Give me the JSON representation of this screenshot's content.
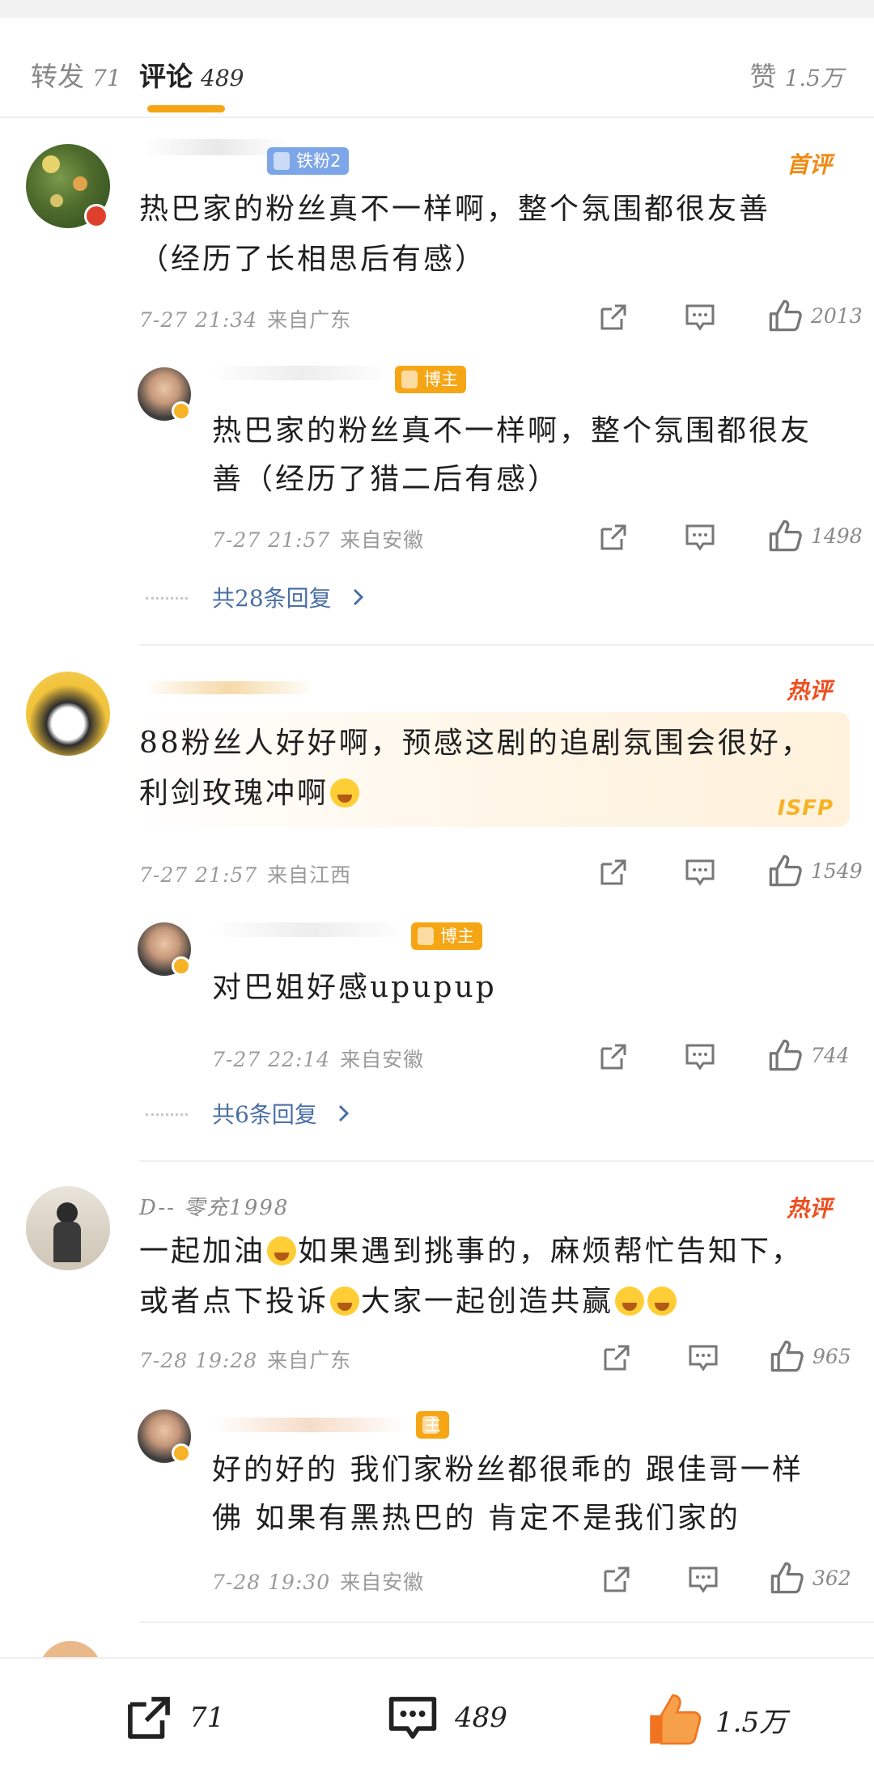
{
  "tabs": {
    "repost": {
      "label": "转发",
      "count": "71"
    },
    "comments": {
      "label": "评论",
      "count": "489"
    },
    "likes": {
      "label": "赞",
      "count": "1.5万"
    }
  },
  "comments": [
    {
      "badge": "首评",
      "fan_tag": "铁粉2",
      "text_line1": "热巴家的粉丝真不一样啊，整个氛围都很友善",
      "text_line2": "（经历了长相思后有感）",
      "time": "7-27 21:34",
      "location": "来自广东",
      "likes": "2013",
      "reply": {
        "author_tag": "博主",
        "text_line1": "热巴家的粉丝真不一样啊，整个氛围都很友",
        "text_line2": "善（经历了猎二后有感）",
        "time": "7-27 21:57",
        "location": "来自安徽",
        "likes": "1498"
      },
      "more_replies": "共28条回复"
    },
    {
      "badge": "热评",
      "text_line1": "88粉丝人好好啊，预感这剧的追剧氛围会很好，",
      "text_line2": "利剑玫瑰冲啊",
      "decoration": "ISFP",
      "time": "7-27 21:57",
      "location": "来自江西",
      "likes": "1549",
      "reply": {
        "author_tag": "博主",
        "text_line1": "对巴姐好感upupup",
        "time": "7-27 22:14",
        "location": "来自安徽",
        "likes": "744"
      },
      "more_replies": "共6条回复"
    },
    {
      "badge": "热评",
      "username": "D-- 零充1998",
      "text_line1a": "一起加油",
      "text_line1b": "如果遇到挑事的，麻烦帮忙告知下，",
      "text_line2a": "或者点下投诉",
      "text_line2b": "大家一起创造共赢",
      "time": "7-28 19:28",
      "location": "来自广东",
      "likes": "965",
      "reply": {
        "author_tag": "主",
        "text_line1": "好的好的 我们家粉丝都很乖的 跟佳哥一样",
        "text_line2": "佛 如果有黑热巴的 肯定不是我们家的",
        "time": "7-28 19:30",
        "location": "来自安徽",
        "likes": "362"
      }
    }
  ],
  "bottom_bar": {
    "repost": "71",
    "comments": "489",
    "likes": "1.5万"
  },
  "colors": {
    "accent": "#f6a615",
    "hot": "#ee4e1f",
    "link": "#4a6fa5",
    "like_active": "#f2731f"
  }
}
